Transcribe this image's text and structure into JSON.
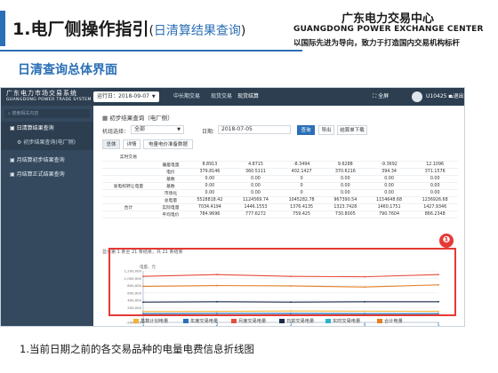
{
  "header": {
    "title_main": "1.电厂侧操作指引",
    "title_open": "(",
    "title_sub": "日清算结果查询",
    "title_close": ")"
  },
  "org": {
    "name_cn": "广东电力交易中心",
    "name_en": "GUANGDONG POWER EXCHANGE CENTER",
    "slogan": "以国际先进为导向，致力于打造国内交易机构标杆"
  },
  "section_title": "日清查询总体界面",
  "app": {
    "logo_cn": "广东电力市场交易系统",
    "logo_en": "GUANGDONG POWER TRADE SYSTEM",
    "date_label": "运行日：2018-09-07",
    "nav": [
      "中长期交易",
      "现货交易",
      "现货结算"
    ],
    "fullscreen": "全屏",
    "user": "U10425",
    "exit": "退出"
  },
  "sidebar": {
    "search_placeholder": "搜索相关内容",
    "items": [
      {
        "label": "日清算结果查询"
      },
      {
        "label": "初步结果查询(电厂侧)"
      },
      {
        "label": "月结算初步结果查询"
      },
      {
        "label": "月结算正式结果查询"
      }
    ]
  },
  "page": {
    "breadcrumb": "初步结果查询（电厂侧）",
    "unit_label": "机组选择：",
    "unit_value": "全部",
    "date_label": "日期:",
    "date_value": "2018-07-05",
    "btn_query": "查询",
    "btn_export": "导出",
    "btn_statement": "结算单下载",
    "tabs": [
      "总体",
      "详情",
      "电量电价准备数据"
    ]
  },
  "table": {
    "rows": [
      {
        "grp": "实时交易",
        "item": "",
        "v": [
          "",
          "",
          "",
          "",
          "",
          ""
        ]
      },
      {
        "grp": "",
        "item": "偏差电量",
        "v": [
          "8.8913",
          "4.8715",
          "-8.3494",
          "9.6288",
          "-9.3692",
          "12.1096"
        ]
      },
      {
        "grp": "",
        "item": "电价",
        "v": [
          "379.8146",
          "360.5111",
          "402.1427",
          "370.6216",
          "394.34",
          "371.1576"
        ]
      },
      {
        "grp": "",
        "item": "基数",
        "v": [
          "0.00",
          "0.00",
          "0",
          "0.00",
          "0.00",
          "0.00"
        ]
      },
      {
        "grp": "发电权转让电量",
        "item": "基数",
        "v": [
          "0.00",
          "0.00",
          "0",
          "0.00",
          "0.00",
          "0.00"
        ]
      },
      {
        "grp": "",
        "item": "市场化",
        "v": [
          "0.00",
          "0.00",
          "0",
          "0.00",
          "0.00",
          "0.00"
        ]
      },
      {
        "grp": "",
        "item": "总电量",
        "v": [
          "5528818.42",
          "1124569.74",
          "1045282.78",
          "967390.54",
          "1154648.68",
          "1236926.68"
        ]
      },
      {
        "grp": "合计",
        "item": "实际电量",
        "v": [
          "7034.4194",
          "1446.1553",
          "1376.4135",
          "1323.7428",
          "1460.1751",
          "1427.9346"
        ]
      },
      {
        "grp": "",
        "item": "平均电价",
        "v": [
          "784.9696",
          "777.6272",
          "759.425",
          "730.8005",
          "790.7604",
          "866.2348"
        ]
      }
    ],
    "footer": "显示第 1 条至 21 条结果，共 21 条结果"
  },
  "chart_data": {
    "type": "line",
    "ylabel": "电量、元",
    "x": [
      1,
      2,
      3,
      4,
      5
    ],
    "x_ticks": [
      "1",
      "2",
      "3",
      "4",
      "5"
    ],
    "ylim": [
      -200000,
      1200000
    ],
    "y_ticks": [
      "1,200,000",
      "1,000,000",
      "800,000",
      "600,000",
      "400,000",
      "200,000",
      "0",
      "-200,000"
    ],
    "grid": true,
    "legend_position": "bottom",
    "series": [
      {
        "name": "基数计划电量",
        "color": "#f2b134",
        "values": [
          95000,
          100000,
          110000,
          105000,
          100000
        ]
      },
      {
        "name": "年度交易电量",
        "color": "#2b6fb6",
        "values": [
          40000,
          45000,
          45000,
          40000,
          40000
        ]
      },
      {
        "name": "月度交易电量",
        "color": "#e74c3c",
        "values": [
          1050000,
          1100000,
          1050000,
          1040000,
          1100000
        ]
      },
      {
        "name": "日前交易电量",
        "color": "#1a2a4a",
        "values": [
          350000,
          360000,
          350000,
          360000,
          360000
        ]
      },
      {
        "name": "实时交易电量",
        "color": "#2bb3c9",
        "values": [
          10000,
          8000,
          9000,
          10000,
          9000
        ]
      },
      {
        "name": "合计电量",
        "color": "#e67e22",
        "values": [
          780000,
          800000,
          790000,
          760000,
          820000
        ]
      }
    ]
  },
  "caption": "1.当前日期之前的各交易品种的电量电费信息折线图"
}
